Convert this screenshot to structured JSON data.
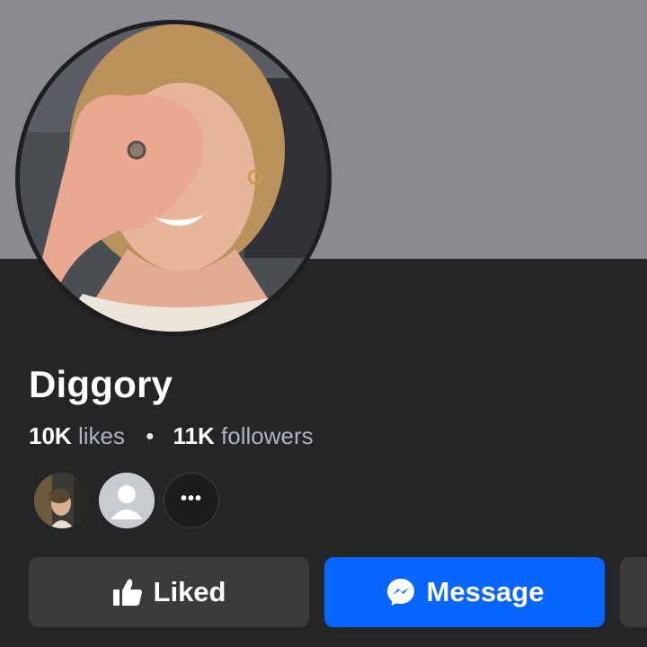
{
  "profile": {
    "name": "Diggory",
    "avatar_icon": "profile-photo"
  },
  "stats": {
    "likes_count": "10K",
    "likes_label": "likes",
    "separator": "•",
    "followers_count": "11K",
    "followers_label": "followers"
  },
  "friends": {
    "more_label": "•••"
  },
  "actions": {
    "liked_label": "Liked",
    "liked_icon": "thumbs-up-icon",
    "message_label": "Message",
    "message_icon": "messenger-icon"
  },
  "colors": {
    "background": "#242526",
    "cover": "#8a8b8f",
    "button_secondary": "#3a3b3c",
    "button_primary": "#0866ff"
  }
}
